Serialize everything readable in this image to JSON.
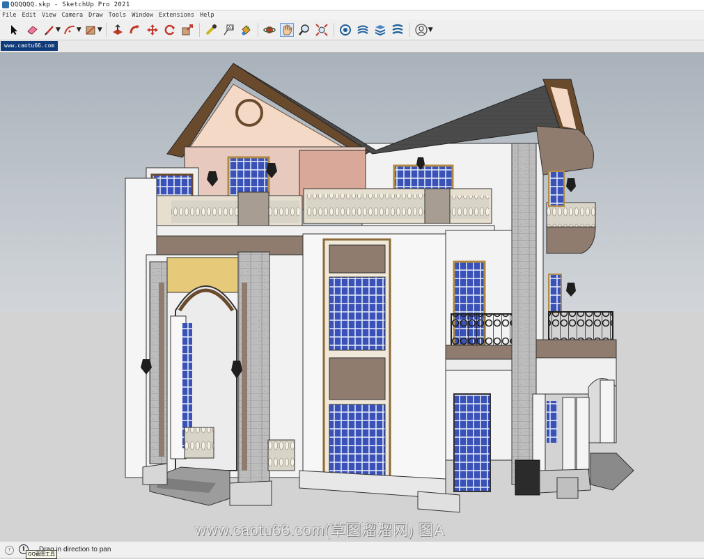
{
  "window": {
    "title": "QQQQQQ.skp - SketchUp Pro 2021"
  },
  "menu": [
    "File",
    "Edit",
    "View",
    "Camera",
    "Draw",
    "Tools",
    "Window",
    "Extensions",
    "Help"
  ],
  "toolbar": {
    "tools": [
      {
        "name": "select-tool-icon"
      },
      {
        "name": "eraser-tool-icon"
      },
      {
        "name": "line-tool-icon",
        "dropdown": true
      },
      {
        "name": "arc-tool-icon",
        "dropdown": true
      },
      {
        "name": "rectangle-tool-icon",
        "dropdown": true
      },
      {
        "name": "push-pull-tool-icon"
      },
      {
        "name": "follow-me-tool-icon"
      },
      {
        "name": "move-tool-icon"
      },
      {
        "name": "rotate-tool-icon"
      },
      {
        "name": "scale-tool-icon"
      },
      {
        "name": "tape-measure-tool-icon"
      },
      {
        "name": "text-tool-icon"
      },
      {
        "name": "paint-bucket-tool-icon"
      },
      {
        "name": "orbit-tool-icon"
      },
      {
        "name": "pan-tool-icon",
        "active": true
      },
      {
        "name": "zoom-tool-icon"
      },
      {
        "name": "zoom-extents-tool-icon"
      },
      {
        "name": "warehouse-icon"
      },
      {
        "name": "extension-warehouse-icon"
      },
      {
        "name": "layout-icon"
      },
      {
        "name": "extension-manager-icon"
      },
      {
        "name": "account-icon",
        "dropdown": true
      }
    ]
  },
  "tabs": [
    {
      "label": "www.caotu66.com",
      "active": true
    }
  ],
  "viewport": {
    "description_colors": {
      "sky": "#a9b2bb",
      "ground": "#d3d3d3",
      "roof": "#4d4d4d",
      "trim": "#6a4a2d",
      "glass": "#3a51b8"
    }
  },
  "status": {
    "text": "Drag in direction to pan",
    "tooltip": "QQ截图工具",
    "watermark": "www.caotu66.com(草图溜溜网) 图A"
  }
}
